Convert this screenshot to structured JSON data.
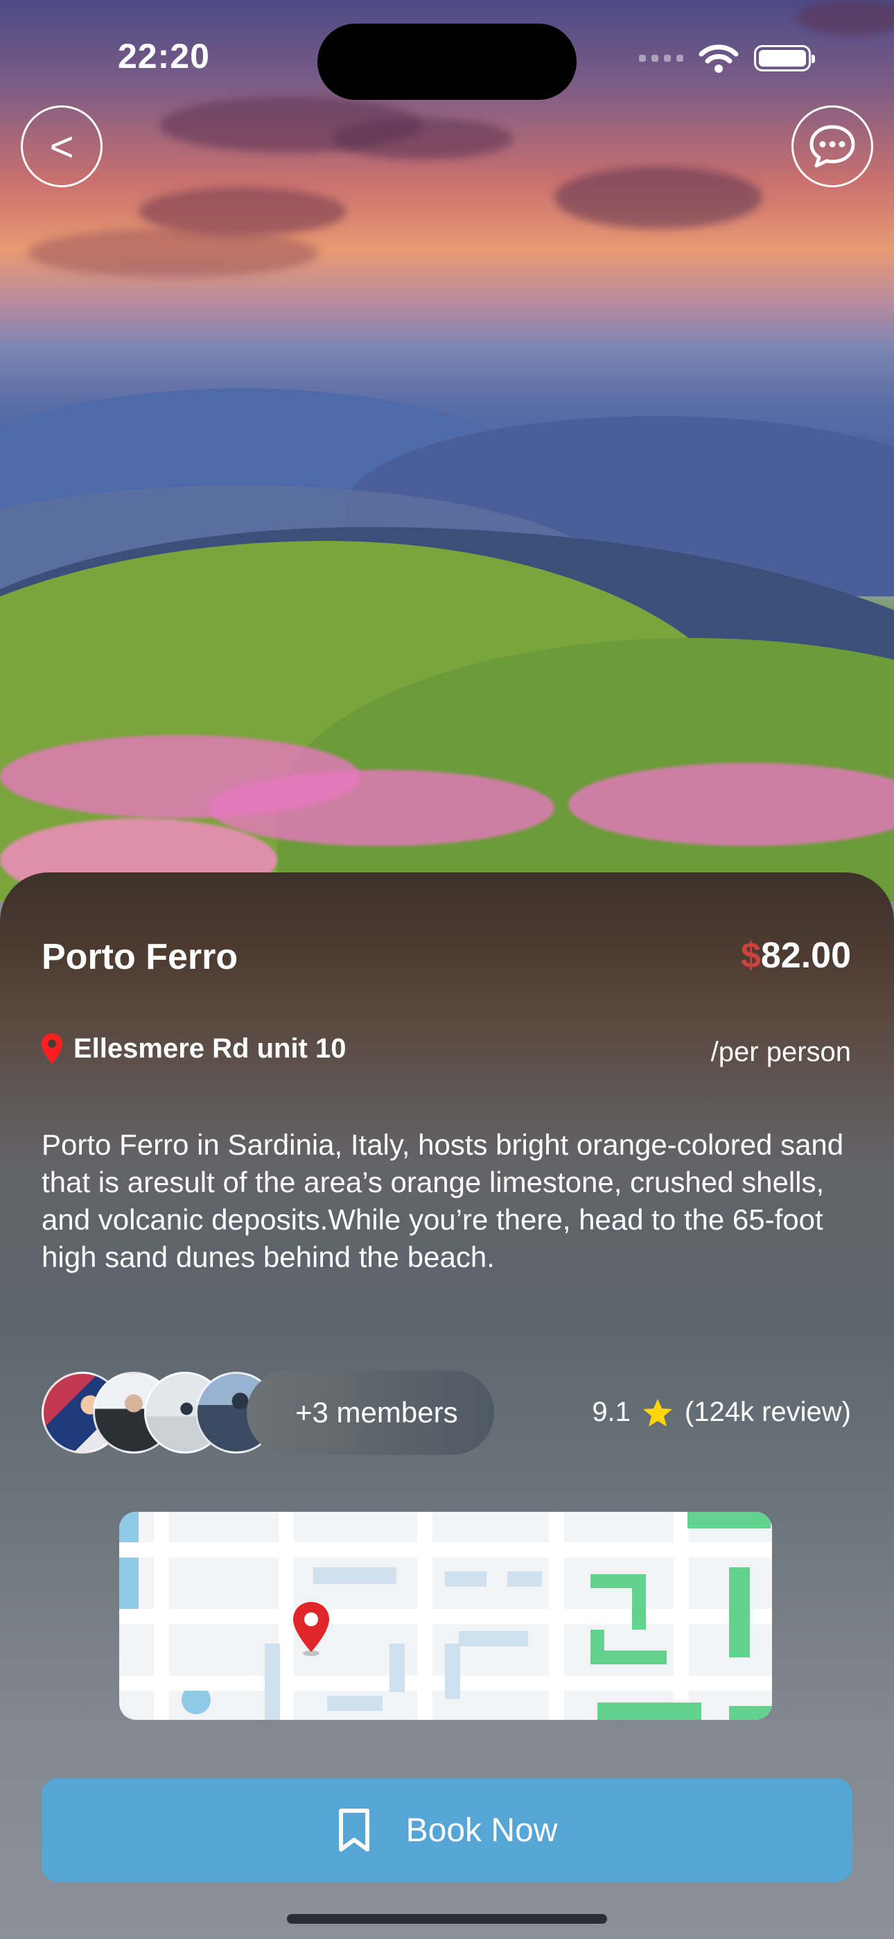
{
  "status_bar": {
    "time": "22:20"
  },
  "header": {
    "back_label": "<",
    "chat_icon": "chat-bubble-icon"
  },
  "place": {
    "title": "Porto Ferro",
    "price_currency": "$",
    "price_amount": "82.00",
    "location_icon": "map-pin-icon",
    "location": "Ellesmere Rd unit 10",
    "price_unit": "/per person",
    "description": "Porto Ferro in Sardinia, Italy, hosts bright orange-colored sand that is aresult of the area’s orange limestone, crushed shells, and volcanic deposits.While you’re there, head to the 65-foot high sand dunes behind the beach."
  },
  "members": {
    "label": "+3 members"
  },
  "rating": {
    "score": "9.1",
    "reviews": "(124k review)",
    "star_color": "#ffd60a"
  },
  "map": {
    "pin_icon": "map-pin-icon"
  },
  "booking": {
    "label": "Book Now",
    "icon": "bookmark-icon",
    "color": "#56a5d7"
  },
  "colors": {
    "accent_price": "#c8453d",
    "pin": "#ff1f1f"
  }
}
